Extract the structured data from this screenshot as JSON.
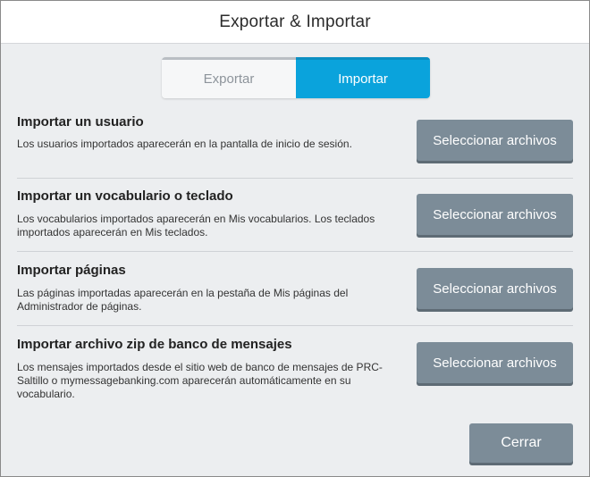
{
  "dialog": {
    "title": "Exportar & Importar"
  },
  "tabs": [
    {
      "label": "Exportar",
      "active": false
    },
    {
      "label": "Importar",
      "active": true
    }
  ],
  "sections": [
    {
      "title": "Importar un usuario",
      "description": "Los usuarios importados aparecerán en la pantalla de inicio de sesión.",
      "button_label": "Seleccionar archivos"
    },
    {
      "title": "Importar un vocabulario o teclado",
      "description": "Los vocabularios importados aparecerán en Mis vocabularios. Los teclados importados aparecerán en Mis teclados.",
      "button_label": "Seleccionar archivos"
    },
    {
      "title": "Importar páginas",
      "description": "Las páginas importadas aparecerán en la pestaña de Mis páginas del Administrador de páginas.",
      "button_label": "Seleccionar archivos"
    },
    {
      "title": "Importar archivo zip de banco de mensajes",
      "description": "Los mensajes importados desde el sitio web de banco de mensajes de PRC-Saltillo o mymessagebanking.com aparecerán automáticamente en su vocabulario.",
      "button_label": "Seleccionar archivos"
    }
  ],
  "footer": {
    "close_label": "Cerrar"
  },
  "colors": {
    "accent": "#0aa3dc",
    "button": "#7c8c98",
    "background": "#eceef0"
  }
}
